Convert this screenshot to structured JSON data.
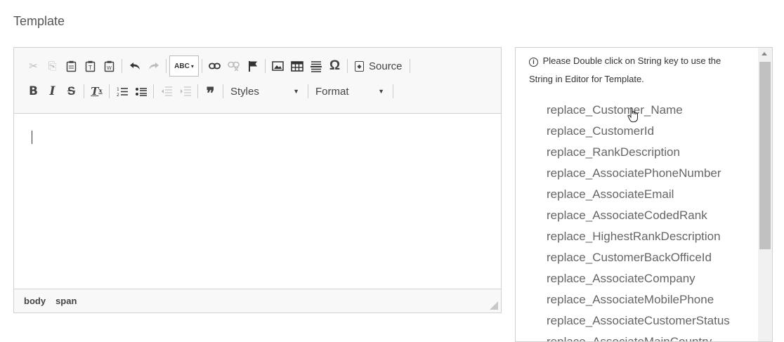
{
  "section_title": "Template",
  "toolbar": {
    "row1": [
      {
        "icon": "cut-icon",
        "glyph": "✂",
        "disabled": true
      },
      {
        "icon": "copy-icon",
        "glyph": "⎘",
        "disabled": true
      },
      {
        "icon": "paste-icon",
        "glyph": "📋",
        "disabled": false
      },
      {
        "icon": "paste-text-icon",
        "glyph": "📋",
        "disabled": false
      },
      {
        "icon": "paste-word-icon",
        "glyph": "📋",
        "disabled": false
      },
      {
        "icon": "undo-icon",
        "glyph": "↶",
        "disabled": false
      },
      {
        "icon": "redo-icon",
        "glyph": "↷",
        "disabled": true
      },
      {
        "icon": "spellcheck-icon",
        "glyph": "ABC"
      },
      {
        "icon": "link-icon",
        "glyph": "🔗",
        "disabled": false
      },
      {
        "icon": "unlink-icon",
        "glyph": "⛓",
        "disabled": true
      },
      {
        "icon": "anchor-flag-icon",
        "glyph": "⚑",
        "disabled": false
      },
      {
        "icon": "image-icon",
        "glyph": "🖼",
        "disabled": false
      },
      {
        "icon": "table-icon",
        "glyph": "▦",
        "disabled": false
      },
      {
        "icon": "horizontal-line-icon",
        "glyph": "≣",
        "disabled": false
      },
      {
        "icon": "special-char-icon",
        "glyph": "Ω",
        "disabled": false
      }
    ],
    "source_label": "Source",
    "styles_label": "Styles",
    "format_label": "Format"
  },
  "status_bar": {
    "path": [
      "body",
      "span"
    ]
  },
  "hint_panel": {
    "info_glyph": "i",
    "hint_text": "Please Double click on String key to use the String in Editor for Template."
  },
  "string_keys": [
    "replace_Customer_Name",
    "replace_CustomerId",
    "replace_RankDescription",
    "replace_AssociatePhoneNumber",
    "replace_AssociateEmail",
    "replace_AssociateCodedRank",
    "replace_HighestRankDescription",
    "replace_CustomerBackOfficeId",
    "replace_AssociateCompany",
    "replace_AssociateMobilePhone",
    "replace_AssociateCustomerStatus",
    "replace_AssociateMainCountry"
  ],
  "colors": {
    "toolbar_bg": "#f8f8f8",
    "border": "#d1d1d1",
    "key_text": "#666666"
  }
}
